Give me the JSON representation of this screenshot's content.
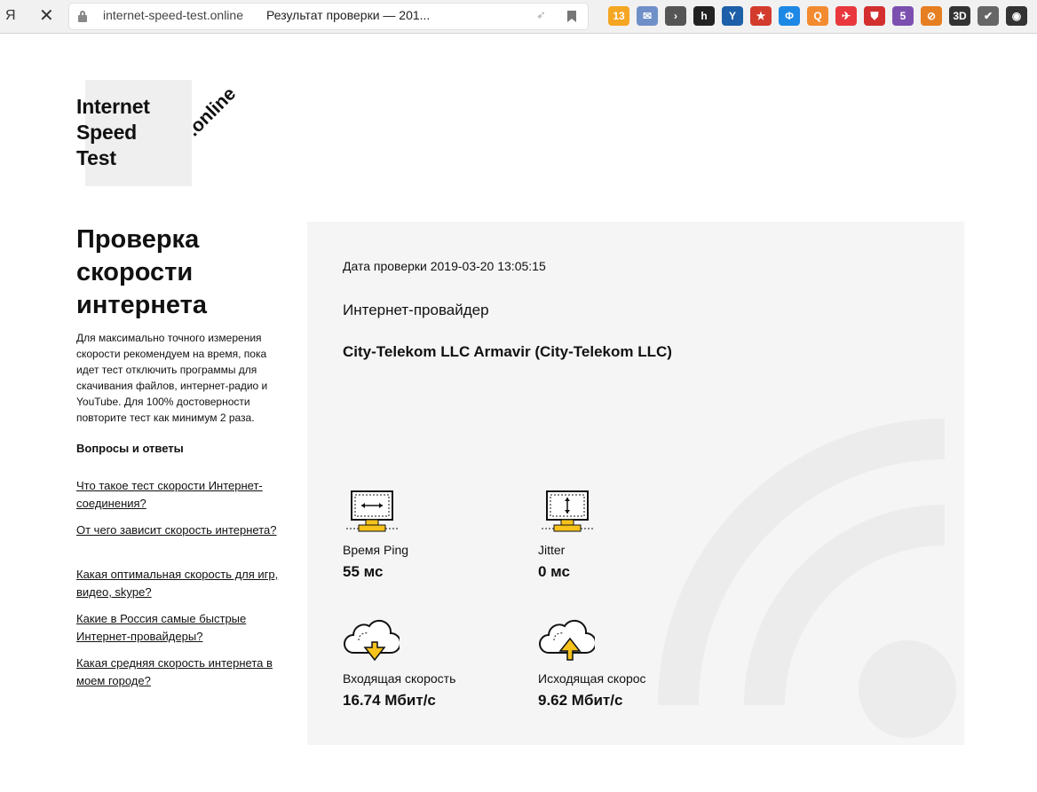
{
  "browser": {
    "yandex_glyph": "Я",
    "close_glyph": "✕",
    "host": "internet-speed-test.online",
    "page_title": "Результат проверки — 201...",
    "extensions": [
      {
        "name": "weather-extension",
        "label": "13",
        "color": "#f5a623"
      },
      {
        "name": "mail-extension",
        "label": "✉",
        "color": "#6f8fc8"
      },
      {
        "name": "arrow-extension",
        "label": "›",
        "color": "#555555"
      },
      {
        "name": "h-extension",
        "label": "h",
        "color": "#222222"
      },
      {
        "name": "y-extension",
        "label": "Y",
        "color": "#1d5fa8"
      },
      {
        "name": "star-extension",
        "label": "★",
        "color": "#d33b2c"
      },
      {
        "name": "phi-extension",
        "label": "Φ",
        "color": "#1e88e5"
      },
      {
        "name": "q-extension",
        "label": "Q",
        "color": "#f28b30"
      },
      {
        "name": "bird-extension",
        "label": "✈",
        "color": "#e8383d"
      },
      {
        "name": "shield-extension",
        "label": "⛊",
        "color": "#d32f2f"
      },
      {
        "name": "five-extension",
        "label": "5",
        "color": "#7b4fb0"
      },
      {
        "name": "link-extension",
        "label": "⊘",
        "color": "#e67e22"
      },
      {
        "name": "threed-extension",
        "label": "3D",
        "color": "#333333"
      },
      {
        "name": "check-extension",
        "label": "✔",
        "color": "#666666"
      },
      {
        "name": "wifi-extension",
        "label": "◉",
        "color": "#333333"
      }
    ]
  },
  "logo": {
    "line1": "Internet",
    "line2": "Speed",
    "line3": "Test",
    "suffix": ".online"
  },
  "intro": {
    "title_l1": "Проверка",
    "title_l2": "скорости",
    "title_l3": "интернета",
    "description": "Для максимально точного измерения скорости рекомендуем на время, пока идет тест отключить программы для скачивания файлов, интернет-радио и YouTube. Для 100% достоверности повторите тест как минимум 2 раза."
  },
  "faq": {
    "heading": "Вопросы и ответы",
    "links": [
      "Что такое тест скорости Интернет-соединения?",
      "От чего зависит скорость интернета?",
      "Какая оптимальная скорость для игр, видео, skype?",
      "Какие в Россия самые быстрые Интернет-провайдеры?",
      "Какая средняя скорость интернета в моем городе?"
    ]
  },
  "result": {
    "date": "Дата проверки 2019-03-20 13:05:15",
    "isp_label": "Интернет-провайдер",
    "isp_name": "City-Telekom LLC Armavir (City-Telekom LLC)",
    "ping": {
      "label": "Время Ping",
      "value": "55 мс"
    },
    "jitter": {
      "label": "Jitter",
      "value": "0 мс"
    },
    "download": {
      "label": "Входящая скорость",
      "value": "16.74 Мбит/с"
    },
    "upload": {
      "label": "Исходящая скорос",
      "value": "9.62 Мбит/с"
    }
  },
  "colors": {
    "accent_yellow": "#f7c21b",
    "panel_bg": "#f5f5f5",
    "wifi_mark": "#ececec"
  }
}
